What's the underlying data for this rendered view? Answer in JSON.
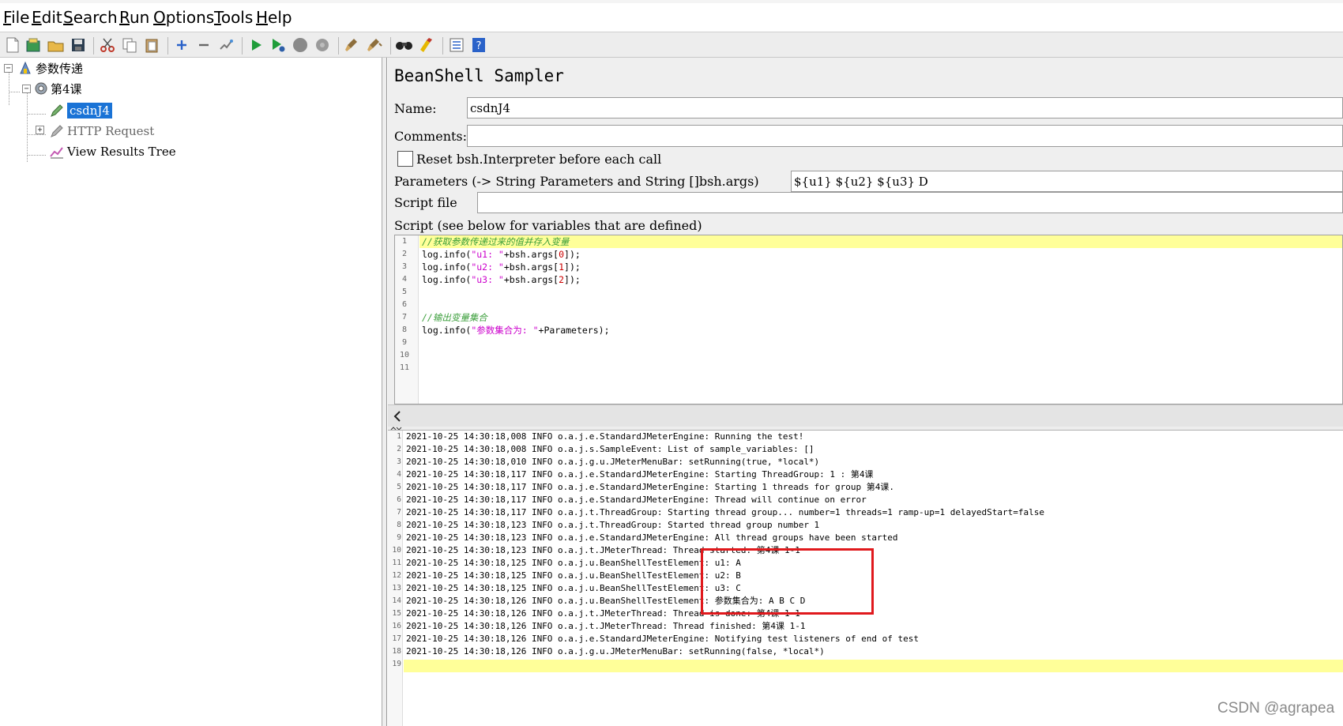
{
  "menubar": {
    "items": [
      "File",
      "Edit",
      "Search",
      "Run",
      "Options",
      "Tools",
      "Help"
    ]
  },
  "toolbar": {
    "icons": [
      "new-icon",
      "templates-icon",
      "open-icon",
      "save-icon",
      "cut-icon",
      "copy-icon",
      "paste-icon",
      "expand-icon",
      "collapse-icon",
      "toggle-icon",
      "start-icon",
      "start-no-pause-icon",
      "stop-icon",
      "shutdown-icon",
      "clear-icon",
      "clear-all-icon",
      "search-icon",
      "reset-search-icon",
      "function-helper-icon",
      "help-icon"
    ]
  },
  "tree": {
    "root": "参数传递",
    "thread_group": "第4课",
    "selected": "csdnJ4",
    "http_request": "HTTP Request",
    "results_tree": "View Results Tree"
  },
  "sampler": {
    "title": "BeanShell Sampler",
    "name_label": "Name:",
    "name_value": "csdnJ4",
    "comments_label": "Comments:",
    "comments_value": "",
    "reset_label": "Reset bsh.Interpreter before each call",
    "reset_checked": false,
    "parameters_label": "Parameters (-> String Parameters and String []bsh.args)",
    "parameters_value": "${u1} ${u2} ${u3} D",
    "script_file_label": "Script file",
    "script_file_value": "",
    "script_label": "Script (see below for variables that are defined)"
  },
  "script": {
    "line_numbers": [
      "1",
      "2",
      "3",
      "4",
      "5",
      "6",
      "7",
      "8",
      "9",
      "10",
      "11"
    ],
    "line1": "//获取参数传递过来的值并存入变量",
    "line2_a": "log.info(",
    "line2_b": "\"u1: \"",
    "line2_c": "+bsh.args[",
    "line2_d": "0",
    "line2_e": "]);",
    "line3_a": "log.info(",
    "line3_b": "\"u2: \"",
    "line3_c": "+bsh.args[",
    "line3_d": "1",
    "line3_e": "]);",
    "line4_a": "log.info(",
    "line4_b": "\"u3: \"",
    "line4_c": "+bsh.args[",
    "line4_d": "2",
    "line4_e": "]);",
    "line7": "//输出变量集合",
    "line8_a": "log.info(",
    "line8_b": "\"参数集合为: \"",
    "line8_c": "+Parameters);"
  },
  "log": {
    "line_numbers": [
      "1",
      "2",
      "3",
      "4",
      "5",
      "6",
      "7",
      "8",
      "9",
      "10",
      "11",
      "12",
      "13",
      "14",
      "15",
      "16",
      "17",
      "18",
      "19"
    ],
    "lines": [
      "2021-10-25 14:30:18,008 INFO o.a.j.e.StandardJMeterEngine: Running the test!",
      "2021-10-25 14:30:18,008 INFO o.a.j.s.SampleEvent: List of sample_variables: []",
      "2021-10-25 14:30:18,010 INFO o.a.j.g.u.JMeterMenuBar: setRunning(true, *local*)",
      "2021-10-25 14:30:18,117 INFO o.a.j.e.StandardJMeterEngine: Starting ThreadGroup: 1 : 第4课",
      "2021-10-25 14:30:18,117 INFO o.a.j.e.StandardJMeterEngine: Starting 1 threads for group 第4课.",
      "2021-10-25 14:30:18,117 INFO o.a.j.e.StandardJMeterEngine: Thread will continue on error",
      "2021-10-25 14:30:18,117 INFO o.a.j.t.ThreadGroup: Starting thread group... number=1 threads=1 ramp-up=1 delayedStart=false",
      "2021-10-25 14:30:18,123 INFO o.a.j.t.ThreadGroup: Started thread group number 1",
      "2021-10-25 14:30:18,123 INFO o.a.j.e.StandardJMeterEngine: All thread groups have been started",
      "2021-10-25 14:30:18,123 INFO o.a.j.t.JMeterThread: Thread started: 第4课 1-1",
      "2021-10-25 14:30:18,125 INFO o.a.j.u.BeanShellTestElement: u1: A",
      "2021-10-25 14:30:18,125 INFO o.a.j.u.BeanShellTestElement: u2: B",
      "2021-10-25 14:30:18,125 INFO o.a.j.u.BeanShellTestElement: u3: C",
      "2021-10-25 14:30:18,126 INFO o.a.j.u.BeanShellTestElement: 参数集合为: A B C D",
      "2021-10-25 14:30:18,126 INFO o.a.j.t.JMeterThread: Thread is done: 第4课 1-1",
      "2021-10-25 14:30:18,126 INFO o.a.j.t.JMeterThread: Thread finished: 第4课 1-1",
      "2021-10-25 14:30:18,126 INFO o.a.j.e.StandardJMeterEngine: Notifying test listeners of end of test",
      "2021-10-25 14:30:18,126 INFO o.a.j.g.u.JMeterMenuBar: setRunning(false, *local*)",
      ""
    ]
  },
  "watermark": "CSDN @agrapea",
  "colors": {
    "selection": "#1a73d6",
    "highlight_line": "#ffff99",
    "comment": "#3b9e3b",
    "string": "#cc00cc",
    "annotation_box": "#e0191d"
  }
}
